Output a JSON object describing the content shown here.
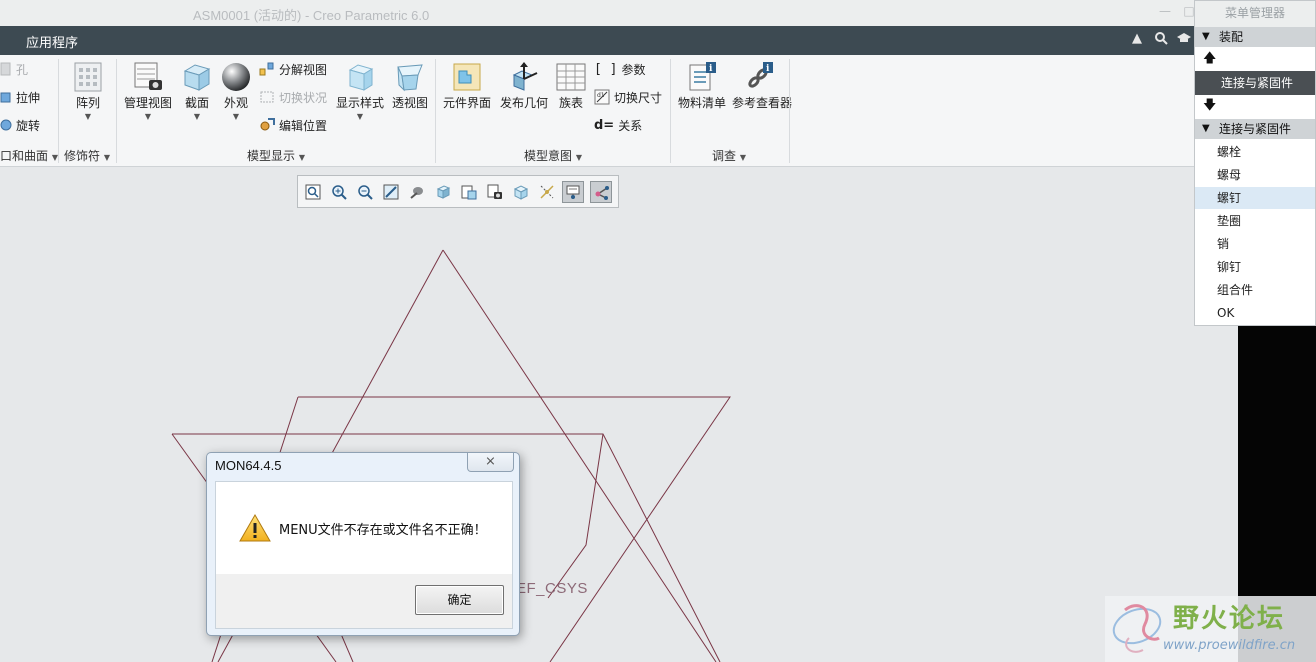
{
  "window": {
    "title": "ASM0001 (活动的) - Creo Parametric 6.0",
    "minimize": "—",
    "maximize": "□"
  },
  "menubar": {
    "app_tab": "应用程序",
    "icons": [
      "collapse-ribbon-icon",
      "search-icon",
      "learning-icon"
    ]
  },
  "ribbon": {
    "cut_group": {
      "hole": "孔",
      "extrude": "拉伸",
      "revolve": "旋转",
      "label": "切口和曲面"
    },
    "modifier_group": {
      "pattern": "阵列",
      "label": "修饰符"
    },
    "model_display": {
      "manage_views": "管理视图",
      "section": "截面",
      "appearance": "外观",
      "exploded_view": "分解视图",
      "toggle_status": "切换状况",
      "edit_position": "编辑位置",
      "display_style": "显示样式",
      "perspective": "透视图",
      "label": "模型显示"
    },
    "model_intent": {
      "component_interface": "元件界面",
      "publish_geometry": "发布几何",
      "family_table": "族表",
      "parameters": "参数",
      "switch_dimensions": "切换尺寸",
      "relations": "关系",
      "label": "模型意图"
    },
    "investigate": {
      "bom": "物料清单",
      "reference_viewer": "参考查看器",
      "label": "调查"
    }
  },
  "view_toolbar": {
    "buttons": [
      "refit-icon",
      "zoom-in-icon",
      "zoom-out-icon",
      "repaint-icon",
      "display-style-icon",
      "saved-views-icon",
      "named-views-icon",
      "view-manager-icon",
      "spin-center-icon",
      "datum-display-icon",
      "annotation-display-icon",
      "csys-display-icon"
    ]
  },
  "canvas": {
    "csys_label": "EF_CSYS"
  },
  "dialog": {
    "title": "MON64.4.5",
    "close": "⨯",
    "message": "MENU文件不存在或文件名不正确！",
    "ok": "确定"
  },
  "menu_manager": {
    "title": "菜单管理器",
    "header_assembly": "装配",
    "dark_row": "连接与紧固件",
    "header_connections": "连接与紧固件",
    "items": [
      "螺栓",
      "螺母",
      "螺钉",
      "垫圈",
      "销",
      "铆钉",
      "组合件",
      "OK"
    ],
    "selected_item": "螺钉"
  },
  "watermark": {
    "logo_text": "野火论坛",
    "url": "www.proewildfire.cn"
  },
  "colors": {
    "menubar": "#3d4a52",
    "sketch_line": "#7a3646",
    "menu_dark_row": "#4a4f53",
    "menu_selected": "#dbe9f5"
  }
}
